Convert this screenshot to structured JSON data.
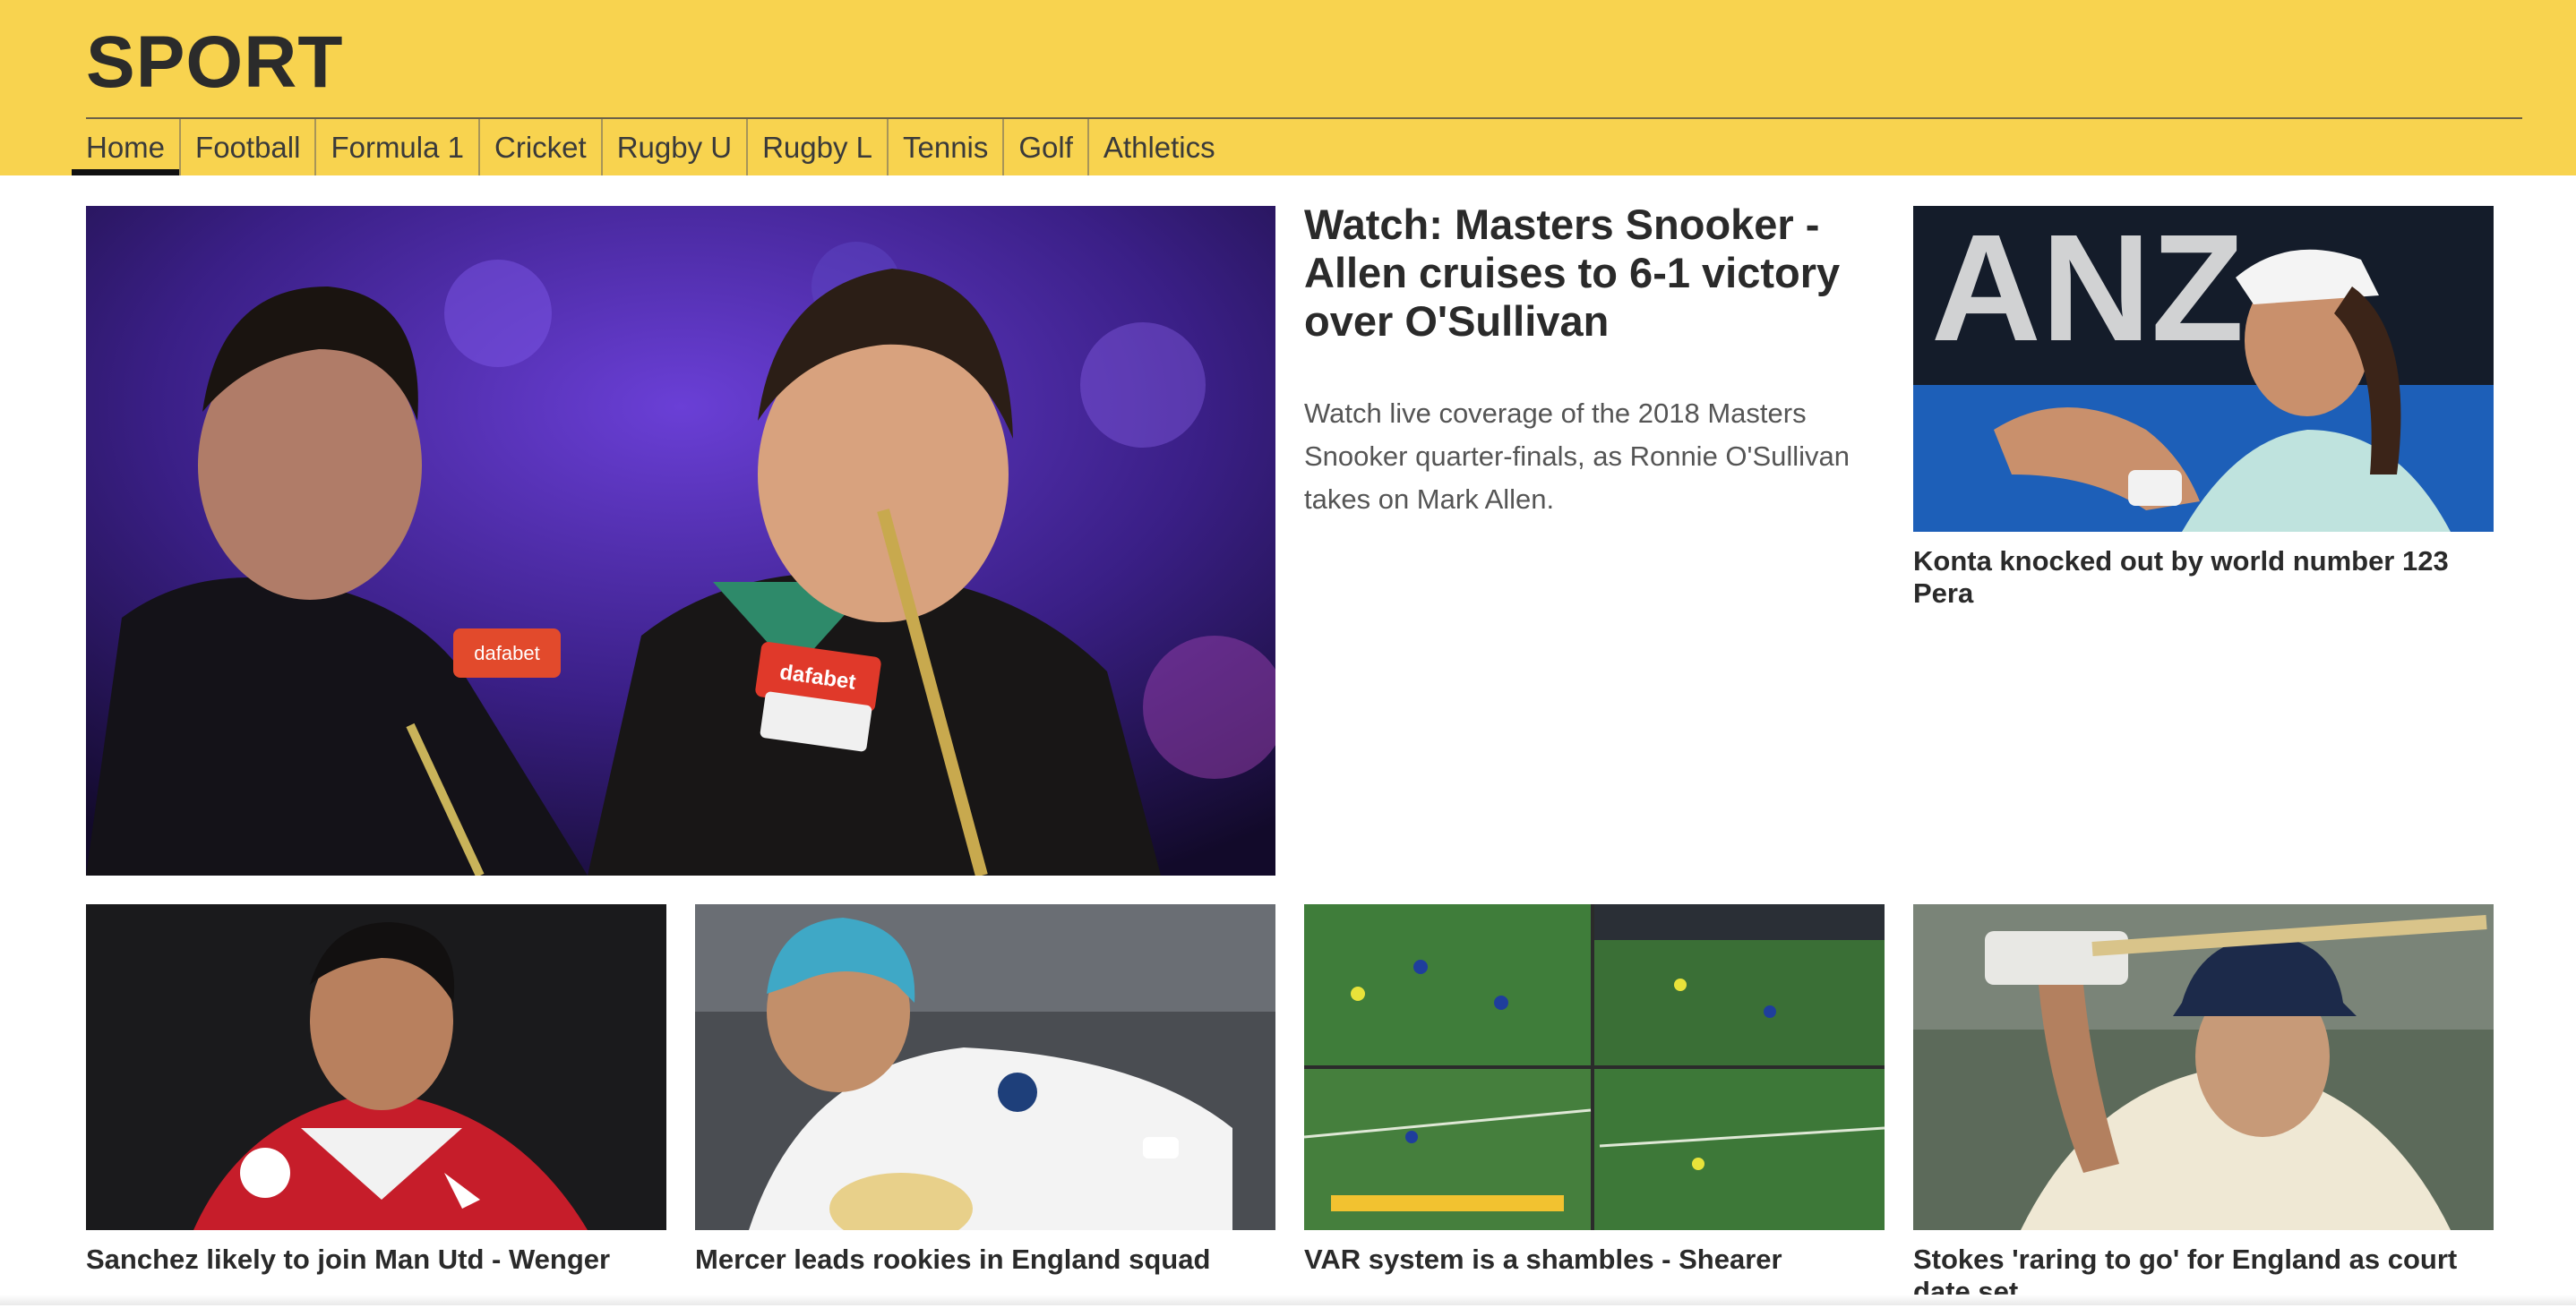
{
  "brand": {
    "title": "SPORT"
  },
  "colors": {
    "header_bg": "#f8d34f",
    "text": "#2a2a2a",
    "summary": "#555555"
  },
  "nav": {
    "items": [
      {
        "label": "Home",
        "active": true
      },
      {
        "label": "Football"
      },
      {
        "label": "Formula 1"
      },
      {
        "label": "Cricket"
      },
      {
        "label": "Rugby U"
      },
      {
        "label": "Rugby L"
      },
      {
        "label": "Tennis"
      },
      {
        "label": "Golf"
      },
      {
        "label": "Athletics"
      }
    ]
  },
  "hero": {
    "title": "Watch: Masters Snooker - Allen cruises to 6-1 victory over O'Sullivan",
    "summary": "Watch live coverage of the 2018 Masters Snooker quarter-finals, as Ronnie O'Sullivan takes on Mark Allen.",
    "image_icon": "snooker-players-photo",
    "image_text": {
      "badge_left": "dafabet",
      "badge_right": "dafabet"
    }
  },
  "side_story": {
    "title": "Konta knocked out by world number 123 Pera",
    "image_icon": "tennis-player-photo",
    "image_text": {
      "banner": "ANZ"
    }
  },
  "cards": [
    {
      "title": "Sanchez likely to join Man Utd - Wenger",
      "image_icon": "footballer-photo"
    },
    {
      "title": "Mercer leads rookies in England squad",
      "image_icon": "rugby-player-photo"
    },
    {
      "title": "VAR system is a shambles - Shearer",
      "image_icon": "football-match-screens-photo"
    },
    {
      "title": "Stokes 'raring to go' for England as court date set",
      "image_icon": "cricketer-photo"
    }
  ]
}
